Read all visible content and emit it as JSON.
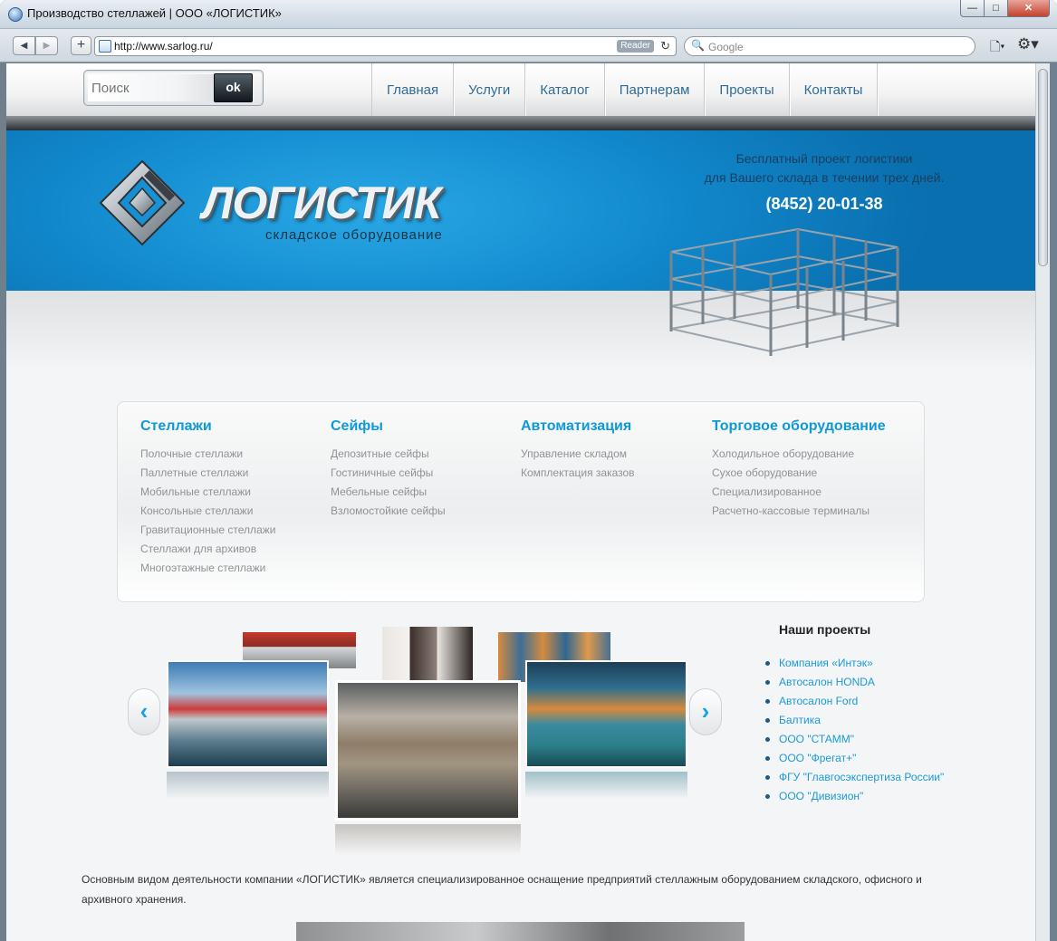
{
  "window": {
    "title": "Производство стеллажей | ООО «ЛОГИСТИК»",
    "minimize": "—",
    "maximize": "□",
    "close": "✕"
  },
  "browser": {
    "back_icon": "◀",
    "forward_icon": "▶",
    "new_tab_icon": "+",
    "url": "http://www.sarlog.ru/",
    "reader_label": "Reader",
    "reload_icon": "↻",
    "search_placeholder": "Google",
    "search_icon": "🔍",
    "page_menu_icon": "🗋▾",
    "settings_icon": "⚙▾"
  },
  "header": {
    "search_placeholder": "Поиск",
    "ok_label": "ok",
    "nav": [
      "Главная",
      "Услуги",
      "Каталог",
      "Партнерам",
      "Проекты",
      "Контакты"
    ]
  },
  "banner": {
    "logo_text": "ЛОГИСТИК",
    "logo_sub": "складское оборудование",
    "promo_line1": "Бесплатный проект логистики",
    "promo_line2": "для Вашего склада в течении трех дней.",
    "phone": "(8452) 20-01-38"
  },
  "categories": [
    {
      "title": "Стеллажи",
      "links": [
        "Полочные стеллажи",
        "Паллетные стеллажи",
        "Мобильные стеллажи",
        "Консольные стеллажи",
        "Гравитационные стеллажи",
        "Стеллажи для архивов",
        "Многоэтажные стеллажи"
      ]
    },
    {
      "title": "Сейфы",
      "links": [
        "Депозитные сейфы",
        "Гостиничные сейфы",
        "Мебельные сейфы",
        "Взломостойкие сейфы"
      ]
    },
    {
      "title": "Автоматизация",
      "links": [
        "Управление складом",
        "Комплектация заказов"
      ]
    },
    {
      "title": "Торговое оборудование",
      "links": [
        "Холодильное оборудование",
        "Сухое оборудование",
        "Специализированное",
        "Расчетно-кассовые терминалы"
      ]
    }
  ],
  "carousel": {
    "prev_icon": "‹",
    "next_icon": "›"
  },
  "projects": {
    "title": "Наши проекты",
    "items": [
      "Компания «Интэк»",
      "Автосалон HONDA",
      "Автосалон Ford",
      "Балтика",
      "ООО \"СТАММ\"",
      "ООО \"Фрегат+\"",
      "ФГУ \"Главгосэкспертиза России\"",
      "ООО \"Дивизион\""
    ]
  },
  "about": {
    "text": "Основным видом деятельности компании «ЛОГИСТИК» является специализированное оснащение предприятий стеллажным оборудованием складского, офисного и архивного хранения."
  },
  "colors": {
    "accent": "#0e9ad9",
    "banner": "#1188cc",
    "nav_text": "#2f6b95"
  }
}
